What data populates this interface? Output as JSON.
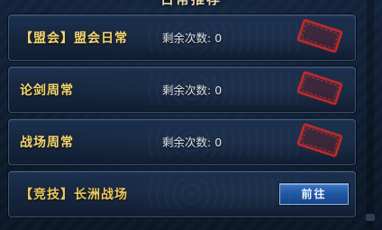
{
  "panel": {
    "title": "日常推荐"
  },
  "activities": [
    {
      "title": "【盟会】盟会日常",
      "count_label": "剩余次数:",
      "count": "0",
      "completed": true,
      "stamp_text": "已完成"
    },
    {
      "title": "论剑周常",
      "count_label": "剩余次数:",
      "count": "0",
      "completed": true,
      "stamp_text": "已完成"
    },
    {
      "title": "战场周常",
      "count_label": "剩余次数:",
      "count": "0",
      "completed": true,
      "stamp_text": "已完成"
    },
    {
      "title": "【竞技】长洲战场",
      "completed": false,
      "button_label": "前往"
    }
  ],
  "colors": {
    "title_gold": "#f1d77a",
    "stamp_red": "#c62828",
    "button_blue": "#1f56a3"
  }
}
